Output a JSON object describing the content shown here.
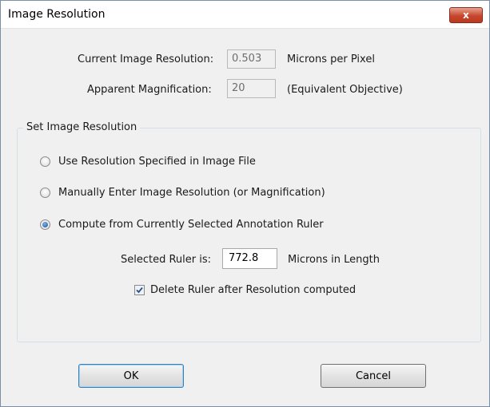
{
  "window": {
    "title": "Image Resolution",
    "close_glyph": "x"
  },
  "current_resolution": {
    "label": "Current Image Resolution:",
    "value": "0.503",
    "unit": "Microns per Pixel"
  },
  "apparent_magnification": {
    "label": "Apparent Magnification:",
    "value": "20",
    "unit": "(Equivalent Objective)"
  },
  "group": {
    "title": "Set Image Resolution",
    "options": [
      {
        "label": "Use Resolution Specified in Image File",
        "checked": false
      },
      {
        "label": "Manually Enter Image Resolution (or Magnification)",
        "checked": false
      },
      {
        "label": "Compute from Currently Selected Annotation Ruler",
        "checked": true
      }
    ],
    "ruler": {
      "label": "Selected Ruler is:",
      "value": "772.8",
      "unit": "Microns in Length"
    },
    "delete_ruler": {
      "label": "Delete Ruler after Resolution computed",
      "checked": true
    }
  },
  "buttons": {
    "ok": "OK",
    "cancel": "Cancel"
  },
  "colors": {
    "close_button": "#c7472e",
    "focus_border": "#3c7fb1"
  }
}
